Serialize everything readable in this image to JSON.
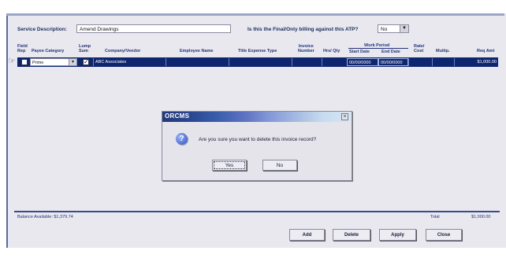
{
  "service": {
    "label": "Service Description:",
    "value": "Amend Drawings",
    "final_label": "Is this the Final/Only billing against this ATP?",
    "final_value": "No"
  },
  "table": {
    "headers": {
      "field_rep": [
        "Field",
        "Rep"
      ],
      "payee_category": "Payee Category",
      "lump_sum": [
        "Lump",
        "Sum"
      ],
      "company_vendor": "Company/Vendor",
      "employee_name": "Employee Name",
      "title_expense_type": "Title Expense Type",
      "invoice_number": [
        "Invoice",
        "Number"
      ],
      "hrs_qty": "Hrs/ Qty",
      "work_period": "Work Period",
      "start_date": "Start Date",
      "end_date": "End Date",
      "rate_cost": [
        "Rate/",
        "Cost"
      ],
      "multip": "Multip.",
      "req_amt": "Req Amt"
    },
    "row": {
      "payee_category": "Prime",
      "company_vendor": "ABC Associates",
      "start_date": "00/00/0000",
      "end_date": "00/00/0000",
      "req_amt": "$1,000.00",
      "lump_sum_checked": true
    }
  },
  "footer": {
    "balance": "Balance Available:  $1,379.74",
    "total_label": "Total",
    "total_value": "$1,000.00"
  },
  "buttons": {
    "add": "Add",
    "delete": "Delete",
    "apply": "Apply",
    "close": "Close"
  },
  "dialog": {
    "title": "ORCMS",
    "message": "Are you sure you want to delete this invoice record?",
    "yes": "Yes",
    "no": "No",
    "close_glyph": "×",
    "icon": "question-icon"
  }
}
